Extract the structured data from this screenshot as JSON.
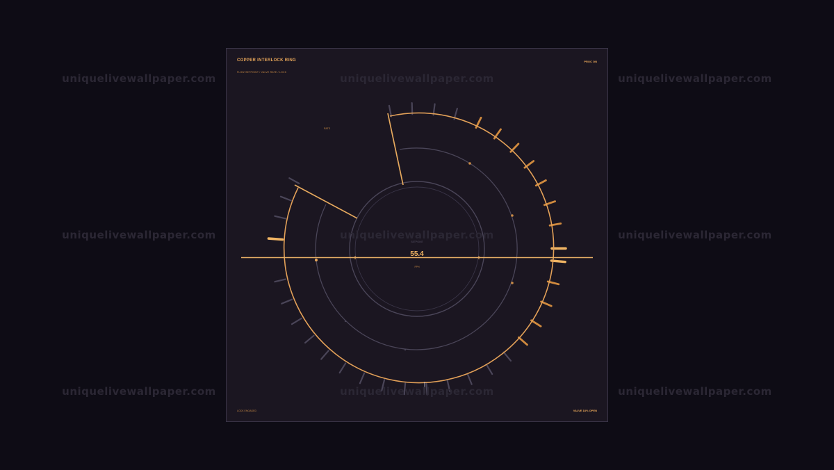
{
  "watermark": "uniquelivewallpaper.com",
  "header": {
    "title": "COPPER INTERLOCK RING",
    "subtitle": "FLOW SETPOINT / VALVE RATE / LOCK",
    "status": "PROC ON"
  },
  "footer": {
    "left_status": "LOCK ENGAGED",
    "right_status": "VALVE 18% OPEN"
  },
  "dial": {
    "readout_value": "55.4",
    "readout_unit": "FPH",
    "readout_caption": "SETPOINT",
    "marker_label": "RATE"
  },
  "colors": {
    "accent": "#e8a75a",
    "accent_dim": "#c98a45",
    "ring_dim": "#4a4558",
    "panel": "#1b1621",
    "background": "#0e0c15"
  }
}
